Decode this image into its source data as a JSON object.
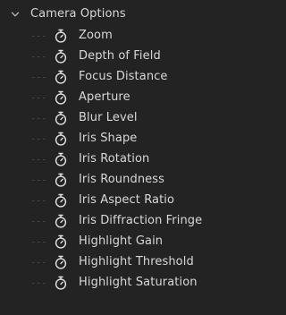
{
  "group": {
    "label": "Camera Options",
    "expanded": true,
    "expander_icon": "chevron-down-icon"
  },
  "properties": [
    {
      "label": "Zoom",
      "icon": "stopwatch-icon"
    },
    {
      "label": "Depth of Field",
      "icon": "stopwatch-icon"
    },
    {
      "label": "Focus Distance",
      "icon": "stopwatch-icon"
    },
    {
      "label": "Aperture",
      "icon": "stopwatch-icon"
    },
    {
      "label": "Blur Level",
      "icon": "stopwatch-icon"
    },
    {
      "label": "Iris Shape",
      "icon": "stopwatch-icon"
    },
    {
      "label": "Iris Rotation",
      "icon": "stopwatch-icon"
    },
    {
      "label": "Iris Roundness",
      "icon": "stopwatch-icon"
    },
    {
      "label": "Iris Aspect Ratio",
      "icon": "stopwatch-icon"
    },
    {
      "label": "Iris Diffraction Fringe",
      "icon": "stopwatch-icon"
    },
    {
      "label": "Highlight Gain",
      "icon": "stopwatch-icon"
    },
    {
      "label": "Highlight Threshold",
      "icon": "stopwatch-icon"
    },
    {
      "label": "Highlight Saturation",
      "icon": "stopwatch-icon"
    }
  ],
  "colors": {
    "panel_background": "#232323",
    "text": "#d8d8d8",
    "icon": "#e2e2e2"
  }
}
